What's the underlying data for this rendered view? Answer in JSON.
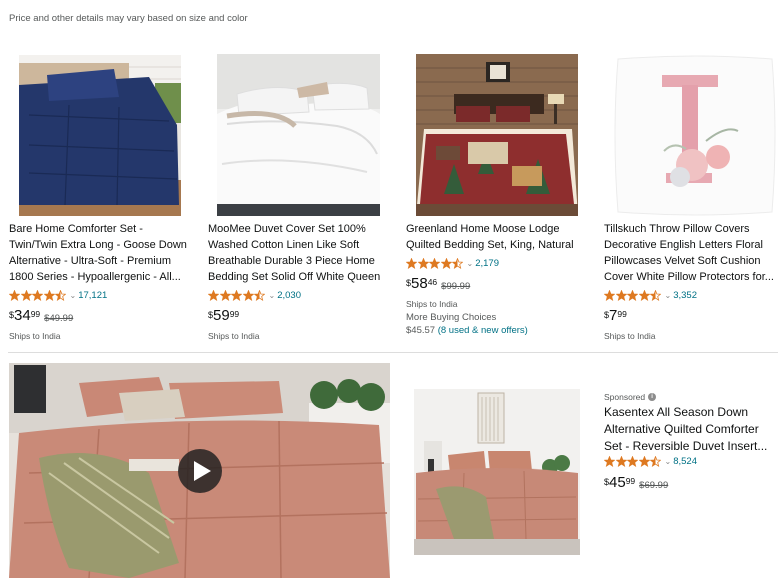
{
  "note": "Price and other details may vary based on size and color",
  "colors": {
    "link": "#007185",
    "star": "#de7921",
    "text": "#0f1111",
    "muted": "#565959"
  },
  "products": [
    {
      "title_lines": [
        "Bare Home Comforter Set -",
        "Twin/Twin Extra Long - Goose Down",
        "Alternative - Ultra-Soft - Premium",
        "1800 Series - Hypoallergenic - All..."
      ],
      "rating_stars": 4.5,
      "review_count": "17,121",
      "price_currency": "$",
      "price_whole": "34",
      "price_fraction": "99",
      "list_price": "$49.99",
      "ships": "Ships to India"
    },
    {
      "title_lines": [
        "MooMee Duvet Cover Set 100%",
        "Washed Cotton Linen Like Soft",
        "Breathable Durable 3 Piece Home",
        "Bedding Set Solid Off White Queen"
      ],
      "rating_stars": 4.5,
      "review_count": "2,030",
      "price_currency": "$",
      "price_whole": "59",
      "price_fraction": "99",
      "ships": "Ships to India"
    },
    {
      "title_lines": [
        "Greenland Home Moose Lodge",
        "Quilted Bedding Set, King, Natural"
      ],
      "rating_stars": 4.5,
      "review_count": "2,179",
      "price_currency": "$",
      "price_whole": "58",
      "price_fraction": "46",
      "list_price": "$99.99",
      "ships": "Ships to India",
      "more_buying": "More Buying Choices",
      "offer_price": "$45.57",
      "offer_link": "(8 used & new offers)"
    },
    {
      "title_lines": [
        "Tillskuch Throw Pillow Covers",
        "Decorative English Letters Floral",
        "Pillowcases Velvet Soft Cushion",
        "Cover White Pillow Protectors for..."
      ],
      "rating_stars": 4.5,
      "review_count": "3,352",
      "price_currency": "$",
      "price_whole": "7",
      "price_fraction": "99",
      "ships": "Ships to India"
    },
    {
      "title_lines": [
        "Kasentex All Season Down",
        "Alternative Quilted Comforter",
        "Set - Reversible Duvet Insert..."
      ],
      "rating_stars": 4.5,
      "review_count": "8,524",
      "price_currency": "$",
      "price_whole": "45",
      "price_fraction": "99",
      "list_price": "$69.99"
    }
  ],
  "sponsored": {
    "label": "Sponsored",
    "icon": "info-icon",
    "icon_glyph": "i"
  },
  "video": {
    "icon": "play-icon"
  }
}
